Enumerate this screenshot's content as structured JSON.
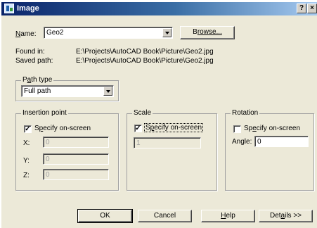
{
  "window": {
    "title": "Image",
    "help_button": "?",
    "close_button": "×"
  },
  "name": {
    "label_u": "N",
    "label_rest": "ame:",
    "value": "Geo2",
    "browse_label_pre": "B",
    "browse_label_rest": "rowse..."
  },
  "paths": {
    "found_label": "Found in:",
    "found_value": "E:\\Projects\\AutoCAD Book\\Picture\\Geo2.jpg",
    "saved_label": "Saved path:",
    "saved_value": "E:\\Projects\\AutoCAD Book\\Picture\\Geo2.jpg"
  },
  "path_type": {
    "title_pre": "P",
    "title_u": "a",
    "title_rest": "th type",
    "value": "Full path"
  },
  "insertion_point": {
    "title": "Insertion point",
    "specify_pre": "S",
    "specify_u": "p",
    "specify_rest": "ecify on-screen",
    "checked": "✓",
    "x_label": "X:",
    "y_label": "Y:",
    "z_label": "Z:",
    "x_value": "0",
    "y_value": "0",
    "z_value": "0"
  },
  "scale": {
    "title": "Scale",
    "specify_pre": "S",
    "specify_u": "p",
    "specify_rest": "ecify on-screen",
    "checked": "✓",
    "value": "1"
  },
  "rotation": {
    "title": "Rotation",
    "specify_pre": "Sp",
    "specify_u": "e",
    "specify_rest": "cify on-screen",
    "angle_label": "Angle:",
    "angle_value": "0"
  },
  "buttons": {
    "ok": "OK",
    "cancel": "Cancel",
    "help_u": "H",
    "help_rest": "elp",
    "details_pre": "Det",
    "details_u": "a",
    "details_rest": "ils >>"
  }
}
